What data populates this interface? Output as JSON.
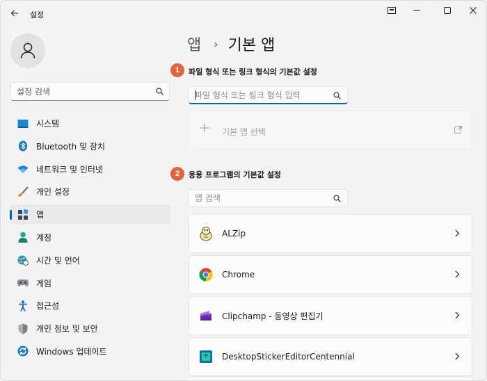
{
  "window": {
    "title": "설정",
    "controls": [
      "snap-icon",
      "minimize-icon",
      "maximize-icon",
      "close-icon"
    ]
  },
  "sidebar": {
    "search_placeholder": "설정 검색",
    "items": [
      {
        "label": "시스템",
        "icon": "system-icon",
        "selected": false
      },
      {
        "label": "Bluetooth 및 장치",
        "icon": "bluetooth-icon",
        "selected": false
      },
      {
        "label": "네트워크 및 인터넷",
        "icon": "wifi-icon",
        "selected": false
      },
      {
        "label": "개인 설정",
        "icon": "brush-icon",
        "selected": false
      },
      {
        "label": "앱",
        "icon": "apps-icon",
        "selected": true
      },
      {
        "label": "계정",
        "icon": "account-icon",
        "selected": false
      },
      {
        "label": "시간 및 언어",
        "icon": "globe-clock-icon",
        "selected": false
      },
      {
        "label": "게임",
        "icon": "gamepad-icon",
        "selected": false
      },
      {
        "label": "접근성",
        "icon": "accessibility-icon",
        "selected": false
      },
      {
        "label": "개인 정보 및 보안",
        "icon": "shield-icon",
        "selected": false
      },
      {
        "label": "Windows 업데이트",
        "icon": "update-icon",
        "selected": false
      }
    ]
  },
  "breadcrumb": {
    "parent": "앱",
    "separator": "›",
    "current": "기본 앱"
  },
  "section1": {
    "badge": "1",
    "title": "파일 형식 또는 링크 형식의 기본값 설정",
    "search_placeholder": "파일 형식 또는 링크 형식 입력",
    "default_app_label": "기본 앱 선택"
  },
  "section2": {
    "badge": "2",
    "title": "응용 프로그램의 기본값 설정",
    "search_placeholder": "앱 검색",
    "apps": [
      {
        "name": "ALZip",
        "icon": "alzip-icon"
      },
      {
        "name": "Chrome",
        "icon": "chrome-icon"
      },
      {
        "name": "Clipchamp - 동영상 편집기",
        "icon": "clipchamp-icon"
      },
      {
        "name": "DesktopStickerEditorCentennial",
        "icon": "sticker-editor-icon"
      }
    ]
  },
  "colors": {
    "accent": "#005fb8",
    "badge": "#e0653f",
    "background": "#f3f3f3"
  }
}
